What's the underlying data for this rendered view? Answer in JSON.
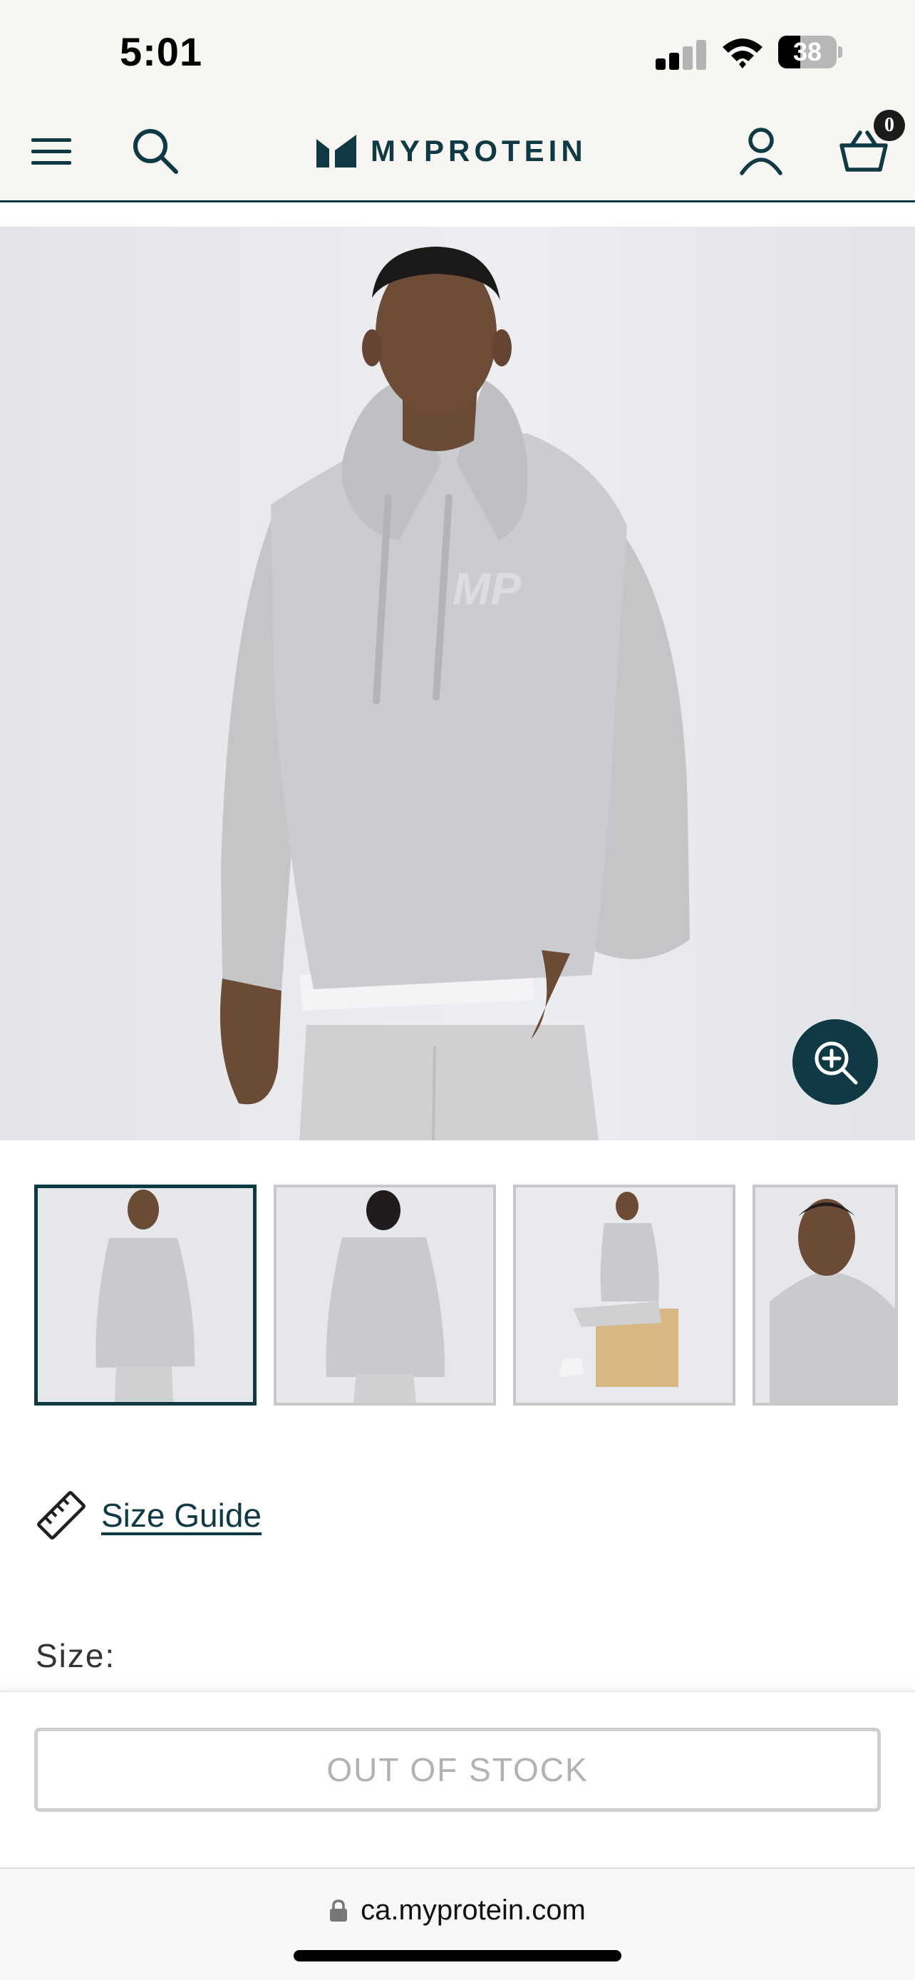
{
  "status_bar": {
    "time": "5:01",
    "battery_level": "38",
    "battery_fraction": 0.38,
    "signal_bars_active": 2,
    "signal_bars_total": 4
  },
  "header": {
    "menu_icon": "hamburger-menu-icon",
    "search_icon": "search-icon",
    "brand_name": "MYPROTEIN",
    "account_icon": "user-icon",
    "basket_icon": "basket-icon",
    "basket_count": "0",
    "brand_color": "#0f3a44"
  },
  "gallery": {
    "zoom_icon": "zoom-in-icon",
    "selected_index": 0,
    "thumbnail_count_visible": 4
  },
  "product": {
    "size_guide_icon": "ruler-icon",
    "size_guide_label": "Size Guide",
    "size_label": "Size:",
    "stock_button_label": "OUT OF STOCK"
  },
  "browser": {
    "lock_icon": "lock-icon",
    "url": "ca.myprotein.com"
  }
}
